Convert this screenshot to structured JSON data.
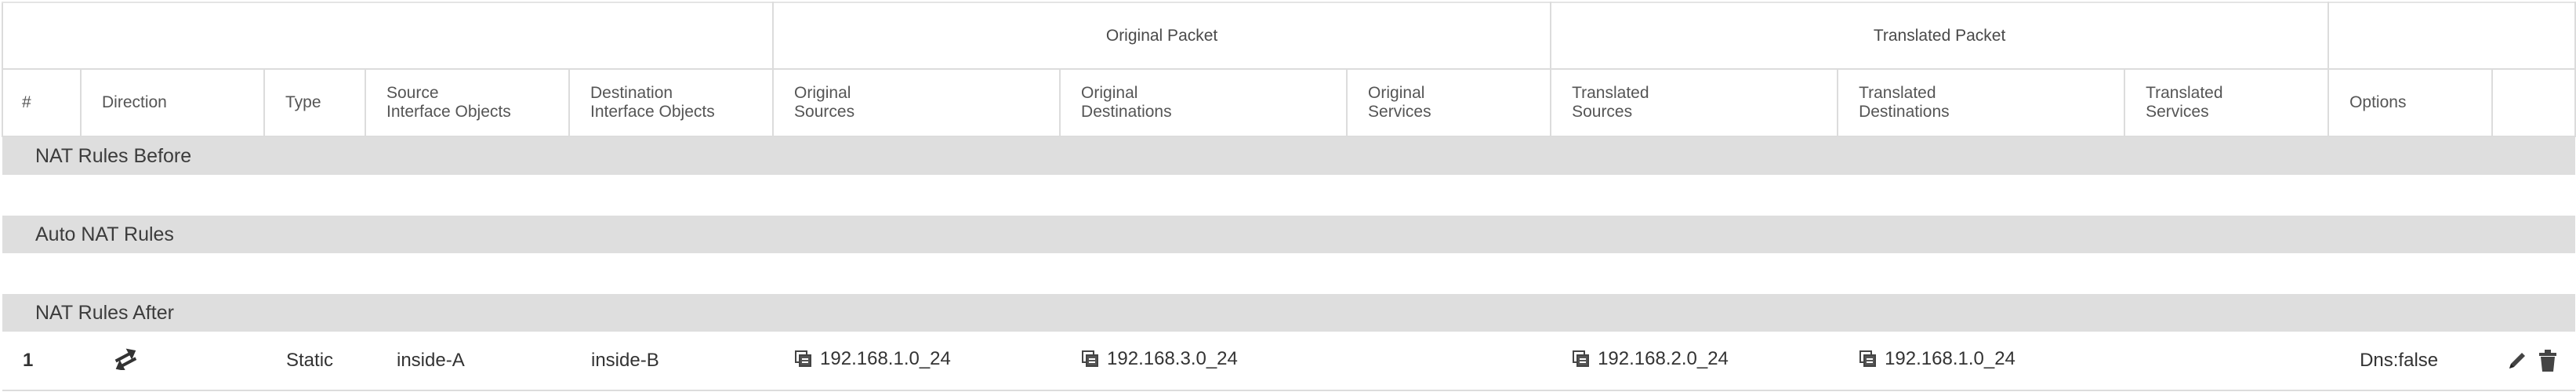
{
  "header": {
    "group_original": "Original Packet",
    "group_translated": "Translated Packet",
    "columns": {
      "num": "#",
      "direction": "Direction",
      "type": "Type",
      "src_if_1": "Source",
      "src_if_2": "Interface Objects",
      "dst_if_1": "Destination",
      "dst_if_2": "Interface Objects",
      "orig_src_1": "Original",
      "orig_src_2": "Sources",
      "orig_dst_1": "Original",
      "orig_dst_2": "Destinations",
      "orig_svc_1": "Original",
      "orig_svc_2": "Services",
      "tr_src_1": "Translated",
      "tr_src_2": "Sources",
      "tr_dst_1": "Translated",
      "tr_dst_2": "Destinations",
      "tr_svc_1": "Translated",
      "tr_svc_2": "Services",
      "options": "Options"
    }
  },
  "sections": {
    "before": "NAT Rules Before",
    "auto": "Auto NAT Rules",
    "after": "NAT Rules After"
  },
  "rules": [
    {
      "num": "1",
      "direction_icon": "bidirectional-arrows-icon",
      "type": "Static",
      "source_interface": "inside-A",
      "destination_interface": "inside-B",
      "original_sources": "192.168.1.0_24",
      "original_destinations": "192.168.3.0_24",
      "original_services": "",
      "translated_sources": "192.168.2.0_24",
      "translated_destinations": "192.168.1.0_24",
      "translated_services": "",
      "options": "Dns:false"
    }
  ],
  "colors": {
    "section_bg": "#dedede",
    "border": "#dcdcdc",
    "text": "#333333",
    "icon": "#444444"
  }
}
